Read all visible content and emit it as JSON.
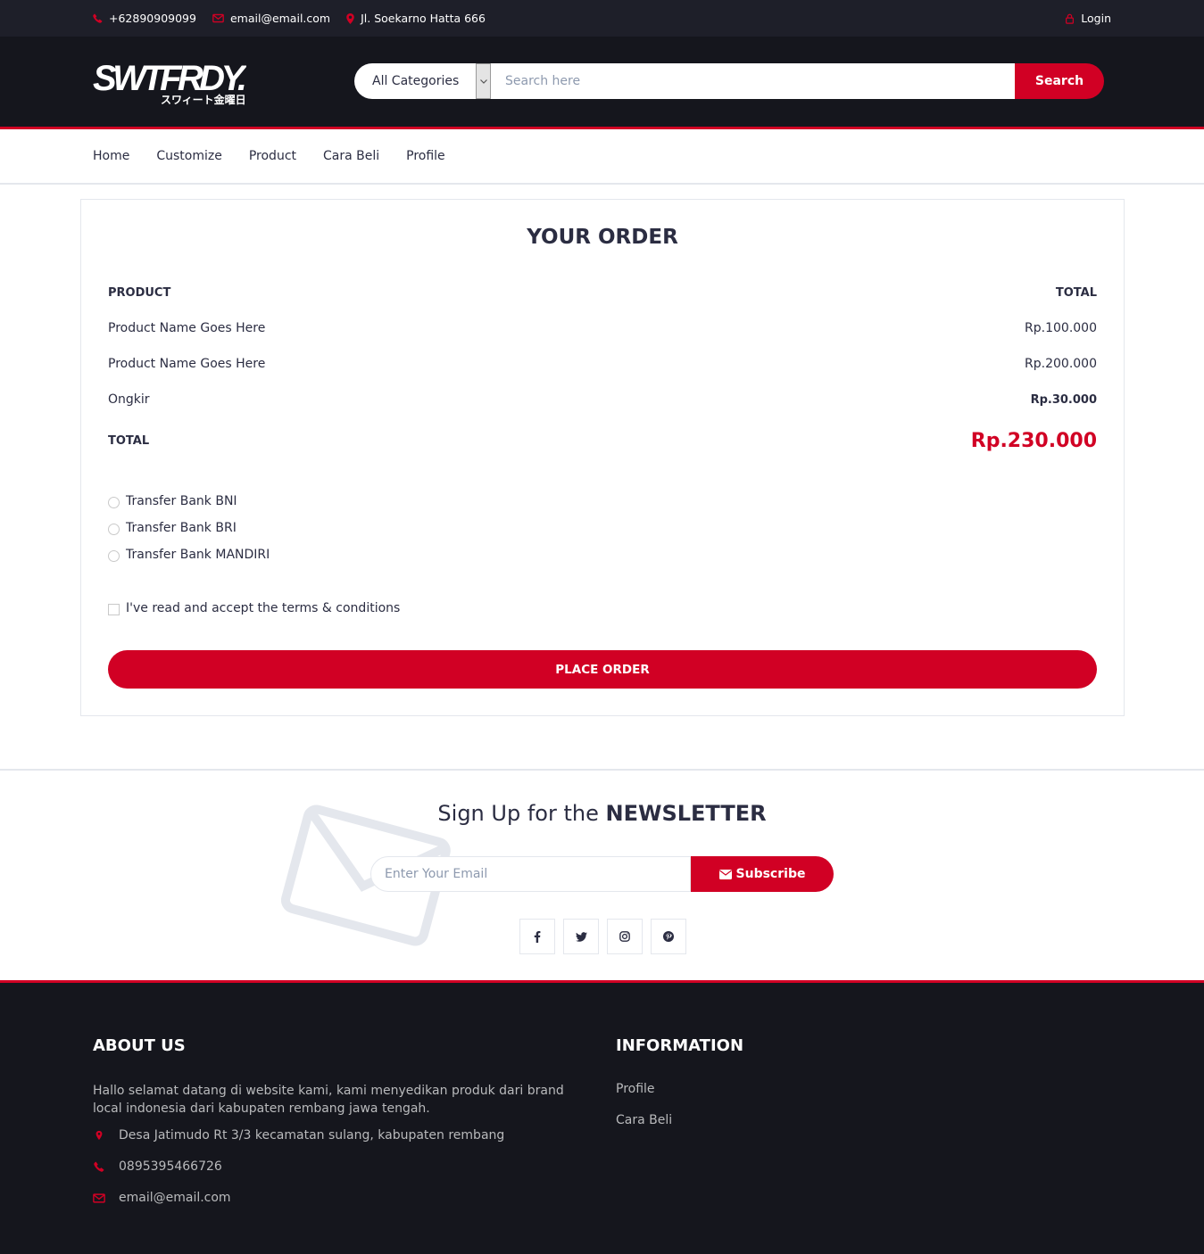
{
  "top_header": {
    "phone": "+62890909099",
    "email": "email@email.com",
    "address": "Jl. Soekarno Hatta 666",
    "login": "Login"
  },
  "header": {
    "logo_text": "SWTFRDY.",
    "logo_subtext": "スワィート金曜日",
    "category_selected": "All Categories",
    "search_placeholder": "Search here",
    "search_button": "Search"
  },
  "nav": {
    "items": [
      "Home",
      "Customize",
      "Product",
      "Cara Beli",
      "Profile"
    ]
  },
  "order": {
    "title": "YOUR ORDER",
    "col_product": "PRODUCT",
    "col_total": "TOTAL",
    "items": [
      {
        "name": "Product Name Goes Here",
        "price": "Rp.100.000"
      },
      {
        "name": "Product Name Goes Here",
        "price": "Rp.200.000"
      }
    ],
    "shipping_label": "Ongkir",
    "shipping_price": "Rp.30.000",
    "total_label": "TOTAL",
    "total_price": "Rp.230.000",
    "payment_options": [
      "Transfer Bank BNI",
      "Transfer Bank BRI",
      "Transfer Bank MANDIRI"
    ],
    "terms_label": "I've read and accept the terms & conditions",
    "place_order": "PLACE ORDER"
  },
  "newsletter": {
    "title_prefix": "Sign Up for the ",
    "title_bold": "NEWSLETTER",
    "email_placeholder": "Enter Your Email",
    "subscribe": "Subscribe",
    "social": [
      "facebook-icon",
      "twitter-icon",
      "instagram-icon",
      "pinterest-icon"
    ]
  },
  "footer": {
    "about_title": "ABOUT US",
    "about_text": "Hallo selamat datang di website kami, kami menyedikan produk dari brand local indonesia dari kabupaten rembang jawa tengah.",
    "address": "Desa Jatimudo Rt 3/3 kecamatan sulang, kabupaten rembang",
    "phone": "0895395466726",
    "email": "email@email.com",
    "info_title": "INFORMATION",
    "info_links": [
      "Profile",
      "Cara Beli"
    ]
  },
  "colors": {
    "accent": "#d10024",
    "dark": "#15161d",
    "top_bar": "#1e1f29"
  }
}
